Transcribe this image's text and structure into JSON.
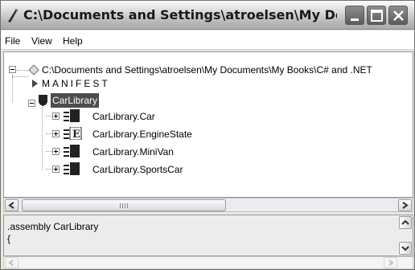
{
  "window": {
    "title": "C:\\Documents and Settings\\atroelsen\\My Docu..."
  },
  "menu": [
    "File",
    "View",
    "Help"
  ],
  "tree": {
    "root": "C:\\Documents and Settings\\atroelsen\\My Documents\\My Books\\C# and .NET",
    "manifest": "MANIFEST",
    "namespace": "CarLibrary",
    "types": [
      {
        "label": "CarLibrary.Car",
        "icon": "class-icon"
      },
      {
        "label": "CarLibrary.EngineState",
        "icon": "enum-icon"
      },
      {
        "label": "CarLibrary.MiniVan",
        "icon": "class-icon"
      },
      {
        "label": "CarLibrary.SportsCar",
        "icon": "class-icon"
      }
    ]
  },
  "code": {
    "lines": [
      ".assembly CarLibrary",
      "{"
    ]
  },
  "colors": {
    "titlebar": "#c4c4c4",
    "selection": "#4d4d4d",
    "panel_border": "#7f9db9"
  }
}
